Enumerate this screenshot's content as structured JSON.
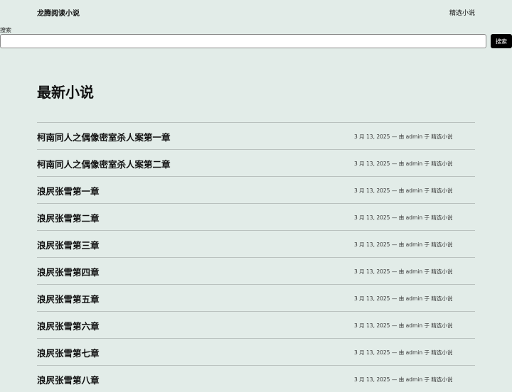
{
  "header": {
    "site_title": "龙腾阅读小说",
    "nav_link": "精选小说"
  },
  "search": {
    "label": "搜索",
    "placeholder": "",
    "button_label": "搜索"
  },
  "main": {
    "heading": "最新小说",
    "posts": [
      {
        "title": "柯南同人之偶像密室杀人案第一章",
        "date": "3 月 13, 2025",
        "sep": "—",
        "by": "由",
        "author": "admin",
        "in": "于",
        "category": "精选小说"
      },
      {
        "title": "柯南同人之偶像密室杀人案第二章",
        "date": "3 月 13, 2025",
        "sep": "—",
        "by": "由",
        "author": "admin",
        "in": "于",
        "category": "精选小说"
      },
      {
        "title": "浪屄张雪第一章",
        "date": "3 月 13, 2025",
        "sep": "—",
        "by": "由",
        "author": "admin",
        "in": "于",
        "category": "精选小说"
      },
      {
        "title": "浪屄张雪第二章",
        "date": "3 月 13, 2025",
        "sep": "—",
        "by": "由",
        "author": "admin",
        "in": "于",
        "category": "精选小说"
      },
      {
        "title": "浪屄张雪第三章",
        "date": "3 月 13, 2025",
        "sep": "—",
        "by": "由",
        "author": "admin",
        "in": "于",
        "category": "精选小说"
      },
      {
        "title": "浪屄张雪第四章",
        "date": "3 月 13, 2025",
        "sep": "—",
        "by": "由",
        "author": "admin",
        "in": "于",
        "category": "精选小说"
      },
      {
        "title": "浪屄张雪第五章",
        "date": "3 月 13, 2025",
        "sep": "—",
        "by": "由",
        "author": "admin",
        "in": "于",
        "category": "精选小说"
      },
      {
        "title": "浪屄张雪第六章",
        "date": "3 月 13, 2025",
        "sep": "—",
        "by": "由",
        "author": "admin",
        "in": "于",
        "category": "精选小说"
      },
      {
        "title": "浪屄张雪第七章",
        "date": "3 月 13, 2025",
        "sep": "—",
        "by": "由",
        "author": "admin",
        "in": "于",
        "category": "精选小说"
      },
      {
        "title": "浪屄张雪第八章",
        "date": "3 月 13, 2025",
        "sep": "—",
        "by": "由",
        "author": "admin",
        "in": "于",
        "category": "精选小说"
      }
    ]
  },
  "colors": {
    "background": "#e2ece8",
    "button": "#000000",
    "divider": "#b9c1be"
  }
}
